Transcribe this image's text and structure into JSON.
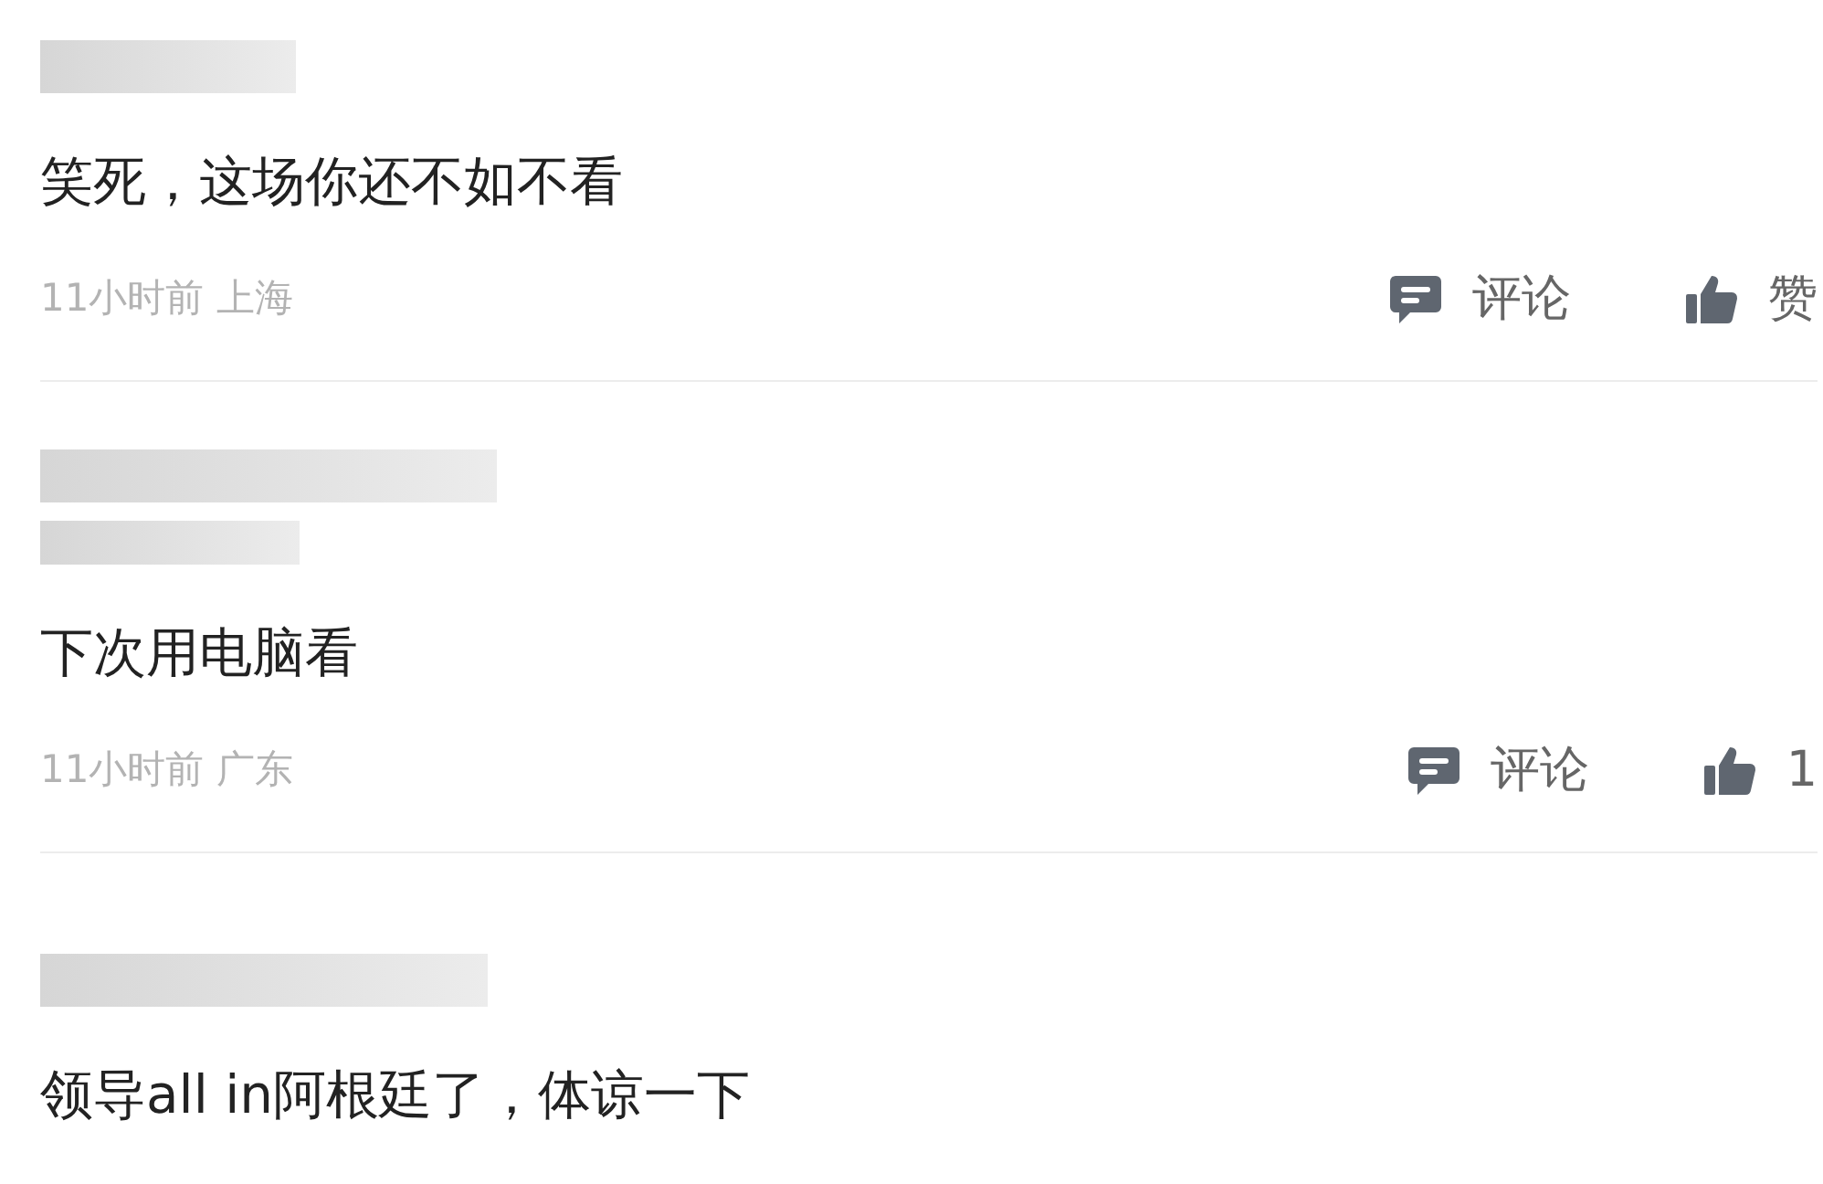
{
  "comments": [
    {
      "author_lines": [
        {
          "kind": "redacted"
        }
      ],
      "text": "笑死，这场你还不如不看",
      "time": "11小时前",
      "location": "上海",
      "reply_label": "评论",
      "like_label": "赞"
    },
    {
      "author_lines": [
        {
          "kind": "redacted"
        },
        {
          "kind": "redacted"
        }
      ],
      "text": "下次用电脑看",
      "time": "11小时前",
      "location": "广东",
      "reply_label": "评论",
      "like_label": "1"
    },
    {
      "author_lines": [
        {
          "kind": "redacted"
        }
      ],
      "text": "领导all in阿根廷了，体谅一下"
    }
  ]
}
